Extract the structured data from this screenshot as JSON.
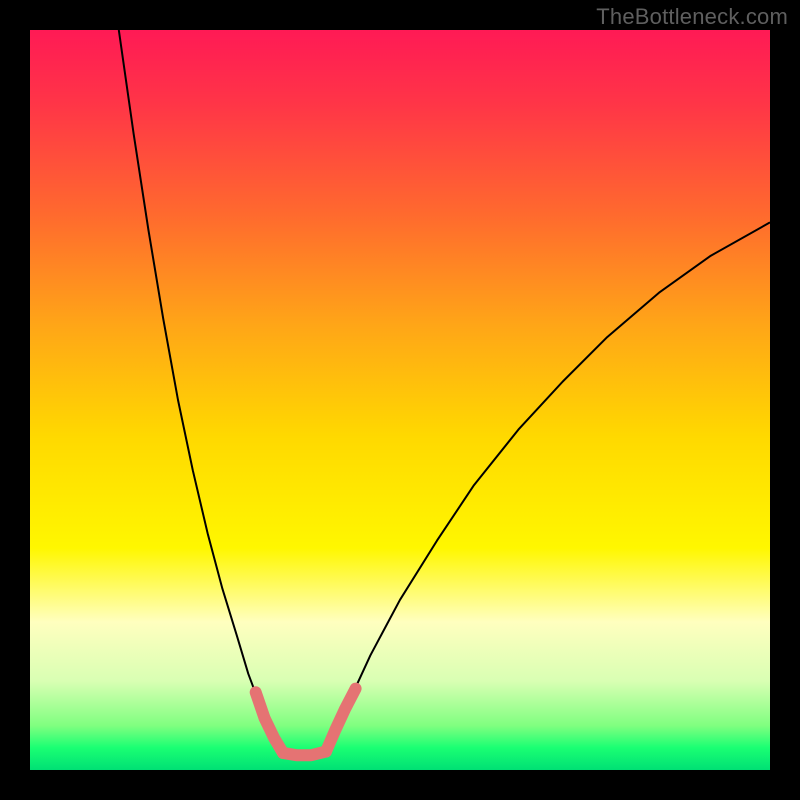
{
  "watermark": "TheBottleneck.com",
  "chart_data": {
    "type": "line",
    "title": "",
    "xlabel": "",
    "ylabel": "",
    "xlim": [
      0,
      100
    ],
    "ylim": [
      0,
      100
    ],
    "background_gradient": {
      "stops": [
        {
          "offset": 0.0,
          "color": "#ff1a55"
        },
        {
          "offset": 0.1,
          "color": "#ff3547"
        },
        {
          "offset": 0.25,
          "color": "#ff6a2e"
        },
        {
          "offset": 0.4,
          "color": "#ffa617"
        },
        {
          "offset": 0.55,
          "color": "#ffd900"
        },
        {
          "offset": 0.7,
          "color": "#fff700"
        },
        {
          "offset": 0.8,
          "color": "#ffffbf"
        },
        {
          "offset": 0.88,
          "color": "#d9ffb3"
        },
        {
          "offset": 0.94,
          "color": "#80ff80"
        },
        {
          "offset": 0.97,
          "color": "#1aff73"
        },
        {
          "offset": 1.0,
          "color": "#00e074"
        }
      ]
    },
    "series": [
      {
        "name": "left-branch",
        "color": "#000000",
        "stroke_width": 2,
        "x": [
          12.0,
          14.0,
          16.0,
          18.0,
          20.0,
          22.0,
          24.0,
          26.0,
          28.0,
          29.5,
          31.0,
          32.5,
          34.0
        ],
        "y": [
          100.0,
          86.0,
          73.0,
          61.0,
          50.0,
          40.5,
          32.0,
          24.5,
          18.0,
          13.0,
          9.0,
          5.5,
          3.0
        ]
      },
      {
        "name": "right-branch",
        "color": "#000000",
        "stroke_width": 2,
        "x": [
          40.0,
          43.0,
          46.0,
          50.0,
          55.0,
          60.0,
          66.0,
          72.0,
          78.0,
          85.0,
          92.0,
          100.0
        ],
        "y": [
          3.0,
          9.0,
          15.5,
          23.0,
          31.0,
          38.5,
          46.0,
          52.5,
          58.5,
          64.5,
          69.5,
          74.0
        ]
      },
      {
        "name": "highlight-left",
        "color": "#e57373",
        "stroke_width": 12,
        "stroke_linecap": "round",
        "x": [
          30.5,
          31.7,
          33.0,
          34.2
        ],
        "y": [
          10.5,
          7.0,
          4.3,
          2.3
        ]
      },
      {
        "name": "highlight-bottom",
        "color": "#e57373",
        "stroke_width": 12,
        "stroke_linecap": "round",
        "x": [
          34.2,
          36.0,
          38.0,
          40.0
        ],
        "y": [
          2.3,
          2.0,
          2.0,
          2.5
        ]
      },
      {
        "name": "highlight-right",
        "color": "#e57373",
        "stroke_width": 12,
        "stroke_linecap": "round",
        "x": [
          40.0,
          41.3,
          42.6,
          44.0
        ],
        "y": [
          2.5,
          5.5,
          8.3,
          11.0
        ]
      }
    ]
  }
}
